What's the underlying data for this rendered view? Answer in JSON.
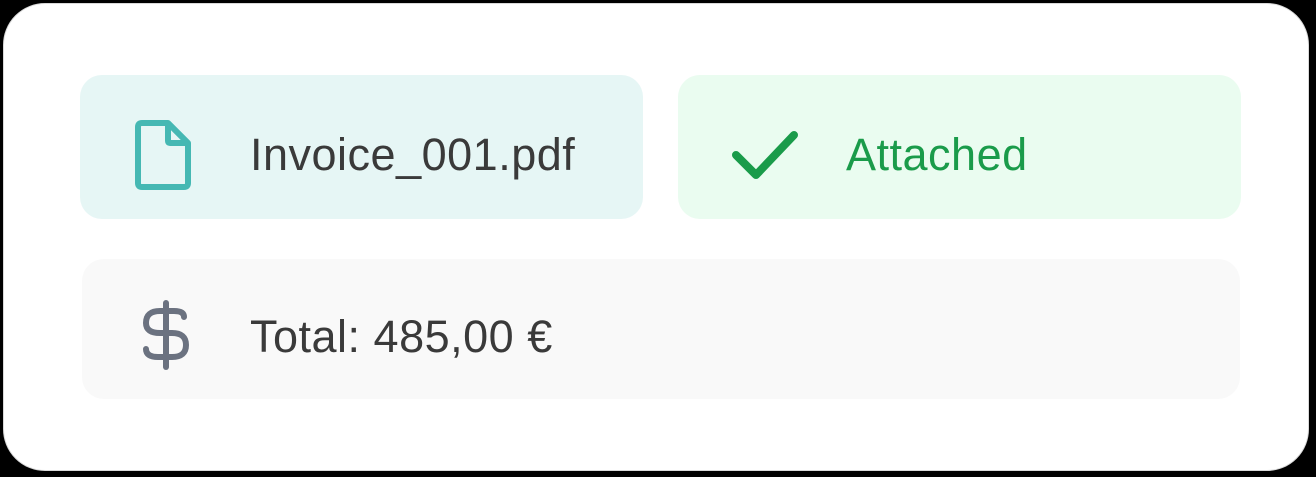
{
  "attachment": {
    "file_name": "Invoice_001.pdf",
    "file_icon": "file-icon",
    "status_label": "Attached",
    "status_icon": "checkmark-icon",
    "status_color": "#1a9b4a",
    "tile_color": "#e6f6f5",
    "status_tile_color": "#eafcf0"
  },
  "summary": {
    "total_label": "Total: 485,00 €",
    "currency_icon": "dollar-icon",
    "tile_color": "#f9f9f9"
  },
  "colors": {
    "accent_teal": "#45b8b3",
    "success_green": "#1a9b4a",
    "icon_gray": "#6b7280"
  }
}
